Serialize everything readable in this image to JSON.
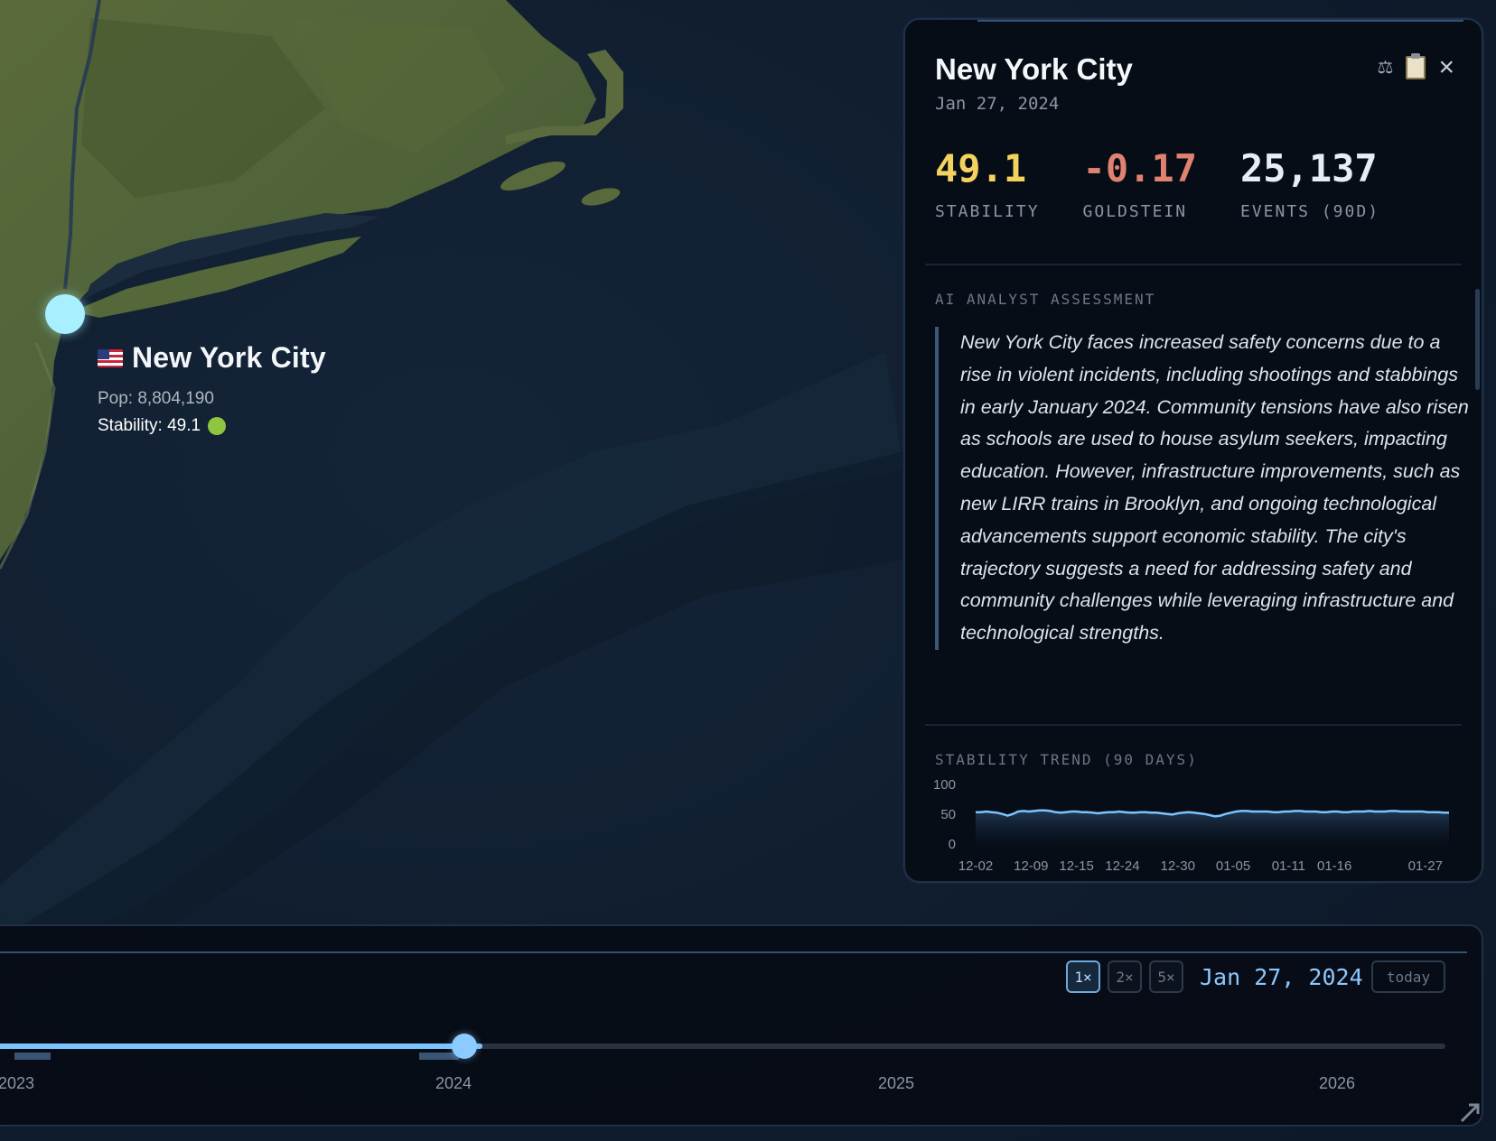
{
  "map": {
    "city_label": "New York City",
    "population": "Pop: 8,804,190",
    "stability": "Stability: 49.1",
    "stability_dot_color": "#8ec63f",
    "marker_color": "#a8f0ff"
  },
  "panel": {
    "title": "New York City",
    "date": "Jan 27, 2024",
    "actions": {
      "compare_icon": "⚖",
      "clipboard_icon": "clipboard-icon",
      "close": "×"
    },
    "metrics": [
      {
        "value": "49.1",
        "label": "STABILITY",
        "color": "#f3d35e"
      },
      {
        "value": "-0.17",
        "label": "GOLDSTEIN",
        "color": "#e0826f"
      },
      {
        "value": "25,137",
        "label": "EVENTS (90D)",
        "color": "#e6edf5"
      }
    ],
    "assessment_heading": "AI ANALYST ASSESSMENT",
    "assessment_text": "New York City faces increased safety concerns due to a rise in violent incidents, including shootings and stabbings in early January 2024. Community tensions have also risen as schools are used to house asylum seekers, impacting education. However, infrastructure improvements, such as new LIRR trains in Brooklyn, and ongoing technological advancements support economic stability. The city's trajectory suggests a need for addressing safety and community challenges while leveraging infrastructure and technological strengths.",
    "trend_heading": "STABILITY TREND (90 DAYS)"
  },
  "chart_data": {
    "type": "area",
    "title": "STABILITY TREND (90 DAYS)",
    "y_ticks": [
      "100",
      "50",
      "0"
    ],
    "ylim": [
      0,
      100
    ],
    "x_tick_labels": [
      "12-02",
      "12-09",
      "12-15",
      "12-24",
      "12-30",
      "01-05",
      "01-11",
      "01-16",
      "01-27"
    ],
    "values": [
      52,
      52,
      53,
      52,
      51,
      49,
      46,
      49,
      53,
      54,
      53,
      54,
      55,
      55,
      54,
      52,
      51,
      52,
      53,
      53,
      52,
      52,
      51,
      50,
      51,
      52,
      52,
      53,
      52,
      51,
      51,
      52,
      52,
      51,
      51,
      50,
      49,
      48,
      50,
      51,
      52,
      51,
      50,
      49,
      47,
      45,
      46,
      49,
      51,
      53,
      54,
      54,
      53,
      53,
      53,
      53,
      52,
      52,
      53,
      53,
      54,
      54,
      53,
      53,
      53,
      52,
      52,
      53,
      53,
      52,
      52,
      53,
      53,
      53,
      54,
      53,
      53,
      53,
      54,
      54,
      53,
      53,
      53,
      53,
      53,
      52,
      52,
      52,
      51,
      51
    ],
    "line_color": "#7cc4ff",
    "grid": false
  },
  "timeline": {
    "speeds": [
      {
        "label": "1×",
        "active": true
      },
      {
        "label": "2×",
        "active": false
      },
      {
        "label": "5×",
        "active": false
      }
    ],
    "current_date": "Jan 27, 2024",
    "today_label": "today",
    "years": [
      "2023",
      "2024",
      "2025",
      "2026"
    ],
    "progress_fraction": 0.34
  }
}
